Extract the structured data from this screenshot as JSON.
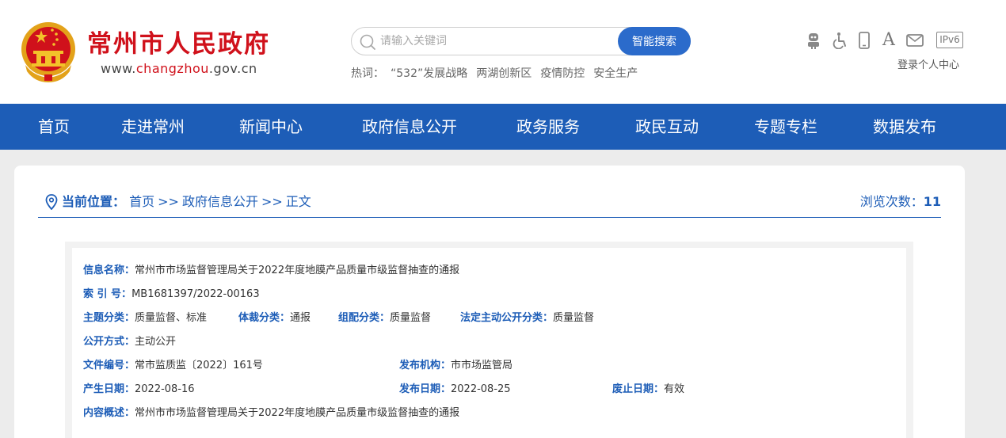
{
  "header": {
    "site_title": "常州市人民政府",
    "url_prefix": "www.",
    "url_highlight": "changzhou",
    "url_suffix": ".gov.cn",
    "search": {
      "placeholder": "请输入关键词",
      "button_label": "智能搜索"
    },
    "hotwords": {
      "label": "热词：",
      "items": [
        "“532”发展战略",
        "两湖创新区",
        "疫情防控",
        "安全生产"
      ]
    },
    "tools": {
      "icons": [
        "robot-icon",
        "accessibility-icon",
        "mobile-icon",
        "font-size-icon",
        "mail-icon",
        "ipv6-icon"
      ],
      "font_glyph": "A",
      "ipv6_label": "IPv6",
      "login_label": "登录个人中心"
    }
  },
  "nav": {
    "items": [
      "首页",
      "走进常州",
      "新闻中心",
      "政府信息公开",
      "政务服务",
      "政民互动",
      "专题专栏",
      "数据发布"
    ]
  },
  "breadcrumb": {
    "label": "当前位置：",
    "items": [
      "首页",
      "政府信息公开",
      "正文"
    ],
    "separator": ">>",
    "views_label": "浏览次数：",
    "views_count": "11"
  },
  "info": {
    "name_label": "信息名称：",
    "name_value": "常州市市场监督管理局关于2022年度地膜产品质量市级监督抽查的通报",
    "index_label": "索 引 号：",
    "index_value": "MB1681397/2022-00163",
    "topic_label": "主题分类：",
    "topic_value": "质量监督、标准",
    "genre_label": "体裁分类：",
    "genre_value": "通报",
    "group_label": "组配分类：",
    "group_value": "质量监督",
    "legal_label": "法定主动公开分类：",
    "legal_value": "质量监督",
    "mode_label": "公开方式：",
    "mode_value": "主动公开",
    "docno_label": "文件编号：",
    "docno_value": "常市监质监〔2022〕161号",
    "org_label": "发布机构：",
    "org_value": "市市场监管局",
    "created_label": "产生日期：",
    "created_value": "2022-08-16",
    "published_label": "发布日期：",
    "published_value": "2022-08-25",
    "expire_label": "废止日期：",
    "expire_value": "有效",
    "summary_label": "内容概述：",
    "summary_value": "常州市市场监督管理局关于2022年度地膜产品质量市级监督抽查的通报"
  },
  "colors": {
    "brand_red": "#d0111b",
    "nav_blue": "#1d5db7",
    "search_blue": "#2b6bcb",
    "page_bg": "#ececec"
  }
}
